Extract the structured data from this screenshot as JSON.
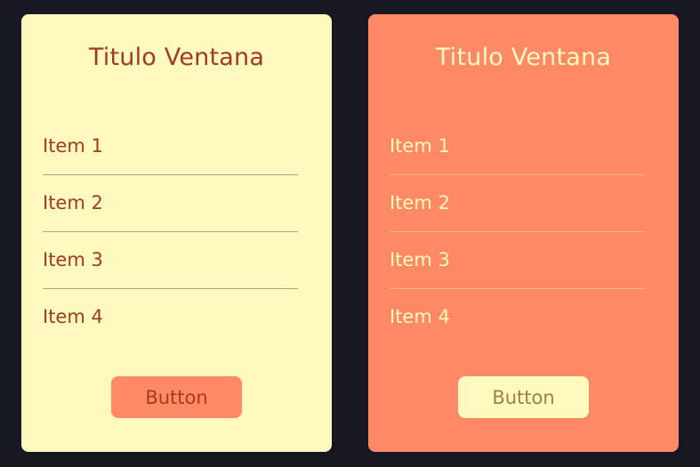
{
  "colors": {
    "background": "#161720",
    "yellow": "#FEF9BF",
    "orange": "#FF8865",
    "dark_red": "#A33B1E",
    "olive": "#A27F3A"
  },
  "cards": [
    {
      "title": "Titulo Ventana",
      "items": [
        "Item 1",
        "Item 2",
        "Item 3",
        "Item 4"
      ],
      "button_label": "Button"
    },
    {
      "title": "Titulo Ventana",
      "items": [
        "Item 1",
        "Item 2",
        "Item 3",
        "Item 4"
      ],
      "button_label": "Button"
    }
  ]
}
